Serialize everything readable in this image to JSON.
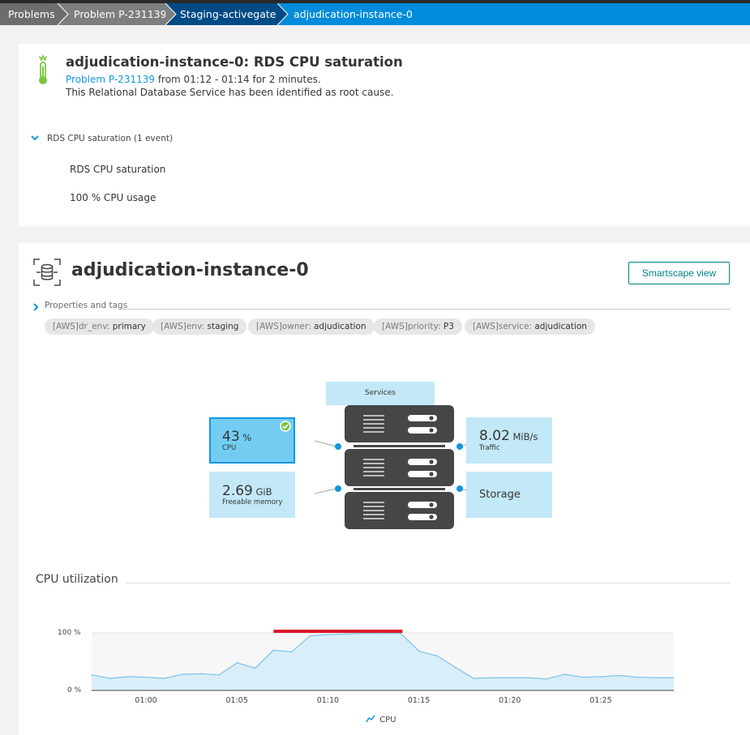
{
  "breadcrumb": {
    "items": [
      "Problems",
      "Problem P-231139",
      "Staging-activegate",
      "adjudication-instance-0"
    ]
  },
  "problem": {
    "title": "adjudication-instance-0: RDS CPU saturation",
    "link_text": "Problem P-231139",
    "time_text": " from 01:12 - 01:14 for 2 minutes.",
    "root_cause_text": "This Relational Database Service has been identified as root cause.",
    "event_group_label": "RDS CPU saturation (1 event)",
    "event_name": "RDS CPU saturation",
    "event_detail": "100 % CPU usage"
  },
  "entity": {
    "title": "adjudication-instance-0",
    "smartscape_button": "Smartscape view",
    "properties_label": "Properties and tags",
    "tags": [
      {
        "key": "[AWS]dr_env: ",
        "value": "primary"
      },
      {
        "key": "[AWS]env: ",
        "value": "staging"
      },
      {
        "key": "[AWS]owner: ",
        "value": "adjudication"
      },
      {
        "key": "[AWS]priority: ",
        "value": "P3"
      },
      {
        "key": "[AWS]service: ",
        "value": "adjudication"
      }
    ]
  },
  "infographic": {
    "services_label": "Services",
    "cpu": {
      "value": "43",
      "unit": " %",
      "label": "CPU"
    },
    "memory": {
      "value": "2.69",
      "unit": " GiB",
      "label": "Freeable memory"
    },
    "traffic": {
      "value": "8.02",
      "unit": " MiB/s",
      "label": "Traffic"
    },
    "storage": {
      "label": "Storage"
    }
  },
  "cpu_section": {
    "title": "CPU utilization",
    "legend": "CPU"
  },
  "colors": {
    "accent": "#008cdb",
    "tile": "#c3e8f8",
    "tile_selected": "#73cdf3",
    "server": "#454646",
    "alert_bar": "#dc172a",
    "area_fill": "#d9eef9",
    "area_line": "#7dc3e8"
  },
  "chart_data": {
    "type": "area",
    "title": "CPU utilization",
    "xlabel": "",
    "ylabel": "",
    "x_ticks": [
      "01:00",
      "01:05",
      "01:10",
      "01:15",
      "01:20",
      "01:25"
    ],
    "y_ticks": [
      "100 %",
      "0 %"
    ],
    "ylim": [
      0,
      100
    ],
    "x_range": [
      "00:57",
      "01:29"
    ],
    "series": [
      {
        "name": "CPU",
        "x": [
          "00:57",
          "00:58",
          "00:59",
          "01:00",
          "01:01",
          "01:02",
          "01:03",
          "01:04",
          "01:05",
          "01:06",
          "01:07",
          "01:08",
          "01:09",
          "01:10",
          "01:11",
          "01:12",
          "01:13",
          "01:14",
          "01:15",
          "01:16",
          "01:17",
          "01:18",
          "01:19",
          "01:20",
          "01:21",
          "01:22",
          "01:23",
          "01:24",
          "01:25",
          "01:26",
          "01:27",
          "01:28",
          "01:29"
        ],
        "values": [
          27,
          21,
          24,
          23,
          21,
          28,
          29,
          27,
          48,
          39,
          70,
          67,
          95,
          97,
          98,
          99,
          99,
          99,
          68,
          60,
          40,
          21,
          22,
          22,
          22,
          20,
          28,
          23,
          24,
          26,
          23,
          22,
          22
        ]
      }
    ],
    "annotations": [
      {
        "label": "problem period",
        "from": "01:07",
        "to": "01:14"
      }
    ],
    "grid": false,
    "legend_position": "bottom"
  }
}
